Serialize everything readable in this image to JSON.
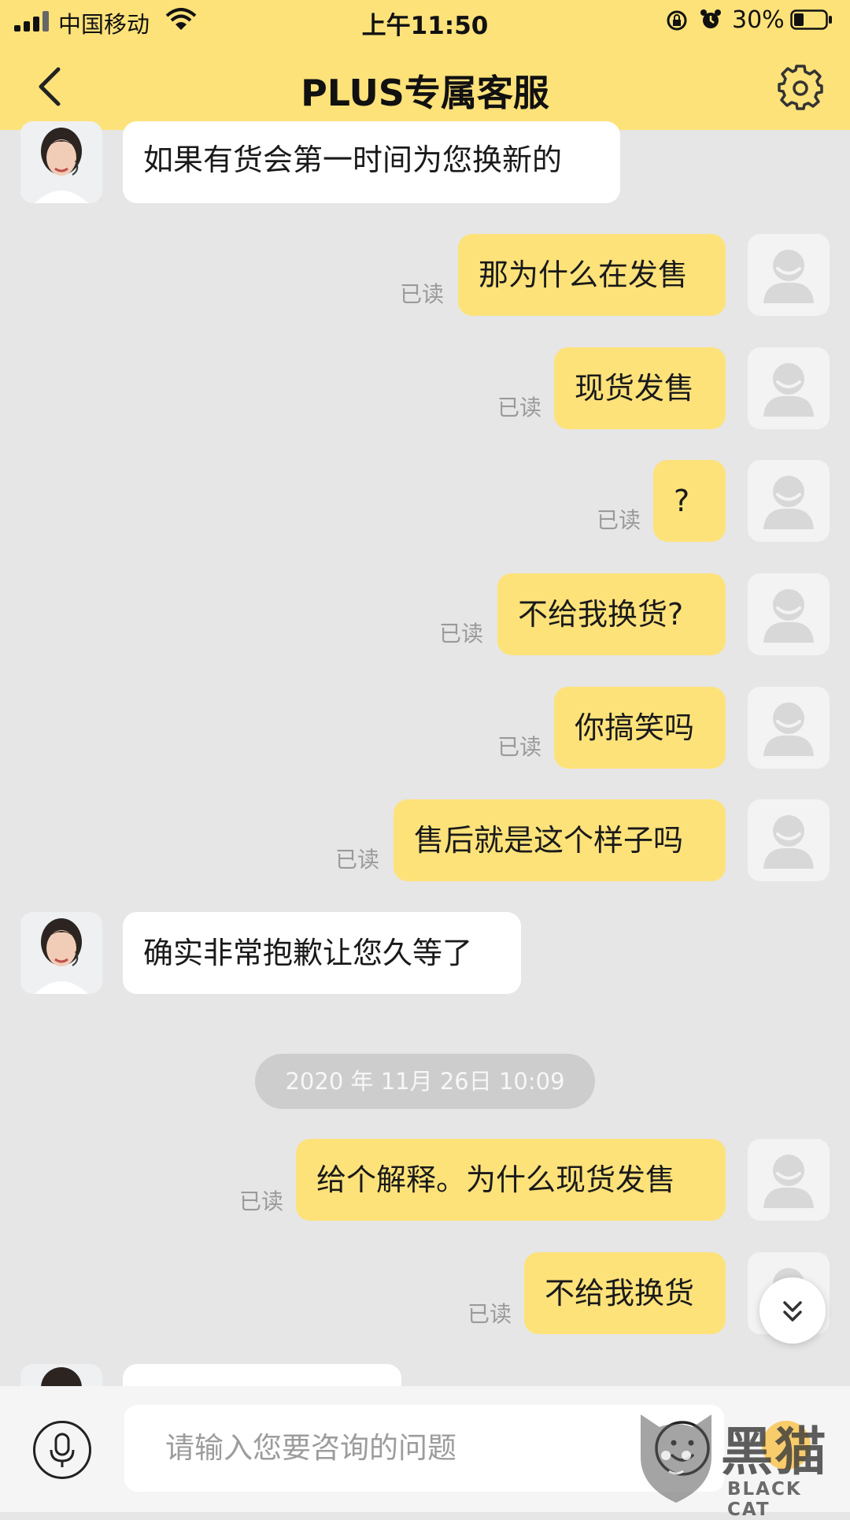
{
  "status_bar": {
    "carrier": "中国移动",
    "time": "上午11:50",
    "battery": "30%"
  },
  "header": {
    "title": "PLUS专属客服",
    "back_icon": "chevron-left-icon",
    "settings_icon": "gear-icon",
    "background": "#fde27a"
  },
  "messages": [
    {
      "sender": "agent",
      "text": "如果有货会第一时间为您换新的"
    },
    {
      "sender": "me",
      "text": "那为什么在发售",
      "status": "已读"
    },
    {
      "sender": "me",
      "text": "现货发售",
      "status": "已读"
    },
    {
      "sender": "me",
      "text": "?",
      "status": "已读"
    },
    {
      "sender": "me",
      "text": "不给我换货?",
      "status": "已读"
    },
    {
      "sender": "me",
      "text": "你搞笑吗",
      "status": "已读"
    },
    {
      "sender": "me",
      "text": "售后就是这个样子吗",
      "status": "已读"
    },
    {
      "sender": "agent",
      "text": "确实非常抱歉让您久等了"
    },
    {
      "sender": "me",
      "text": "给个解释。为什么现货发售",
      "status": "已读"
    },
    {
      "sender": "me",
      "text": "不给我换货",
      "status": "已读"
    }
  ],
  "date_divider": "2020 年 11月 26日 10:09",
  "input": {
    "placeholder": "请输入您要咨询的问题"
  },
  "watermark": {
    "text": "黑猫",
    "sub": "BLACK CAT"
  },
  "colors": {
    "my_bubble": "#fde27a",
    "agent_bubble": "#ffffff",
    "chat_background": "#e6e6e6"
  }
}
